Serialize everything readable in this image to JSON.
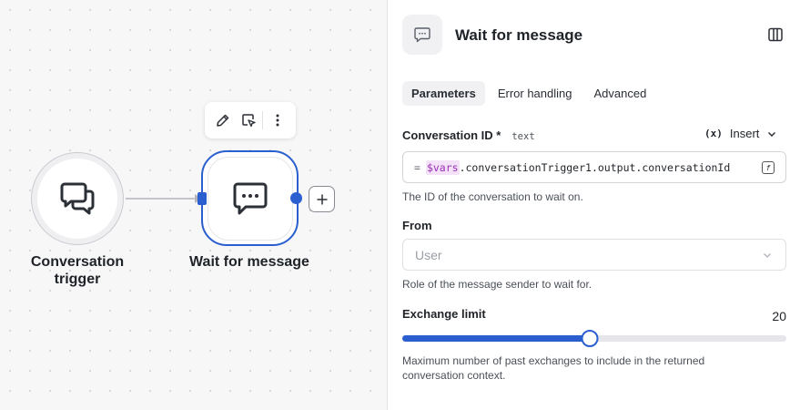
{
  "canvas": {
    "nodes": [
      {
        "label": "Conversation trigger",
        "icon": "chat-bubbles-icon"
      },
      {
        "label": "Wait for message",
        "icon": "message-dots-icon",
        "selected": true
      }
    ],
    "toolbar": [
      "edit-icon",
      "select-icon",
      "more-icon"
    ]
  },
  "panel": {
    "title": "Wait for message",
    "tabs": [
      {
        "label": "Parameters",
        "active": true
      },
      {
        "label": "Error handling",
        "active": false
      },
      {
        "label": "Advanced",
        "active": false
      }
    ],
    "conversation_id": {
      "label": "Conversation ID *",
      "type": "text",
      "insert_label": "Insert",
      "insert_icon_text": "(x)",
      "expr_prefix": "=",
      "expr_var": "$vars",
      "expr_rest": ".conversationTrigger1.output.conversationId",
      "help": "The ID of the conversation to wait on."
    },
    "from": {
      "label": "From",
      "placeholder": "User",
      "help": "Role of the message sender to wait for."
    },
    "exchange_limit": {
      "label": "Exchange limit",
      "value": "20",
      "slider_fraction": 0.488,
      "help": "Maximum number of past exchanges to include in the returned conversation context."
    }
  },
  "colors": {
    "accent": "#2b5fcf",
    "expr_var": "#9b2fb6"
  }
}
